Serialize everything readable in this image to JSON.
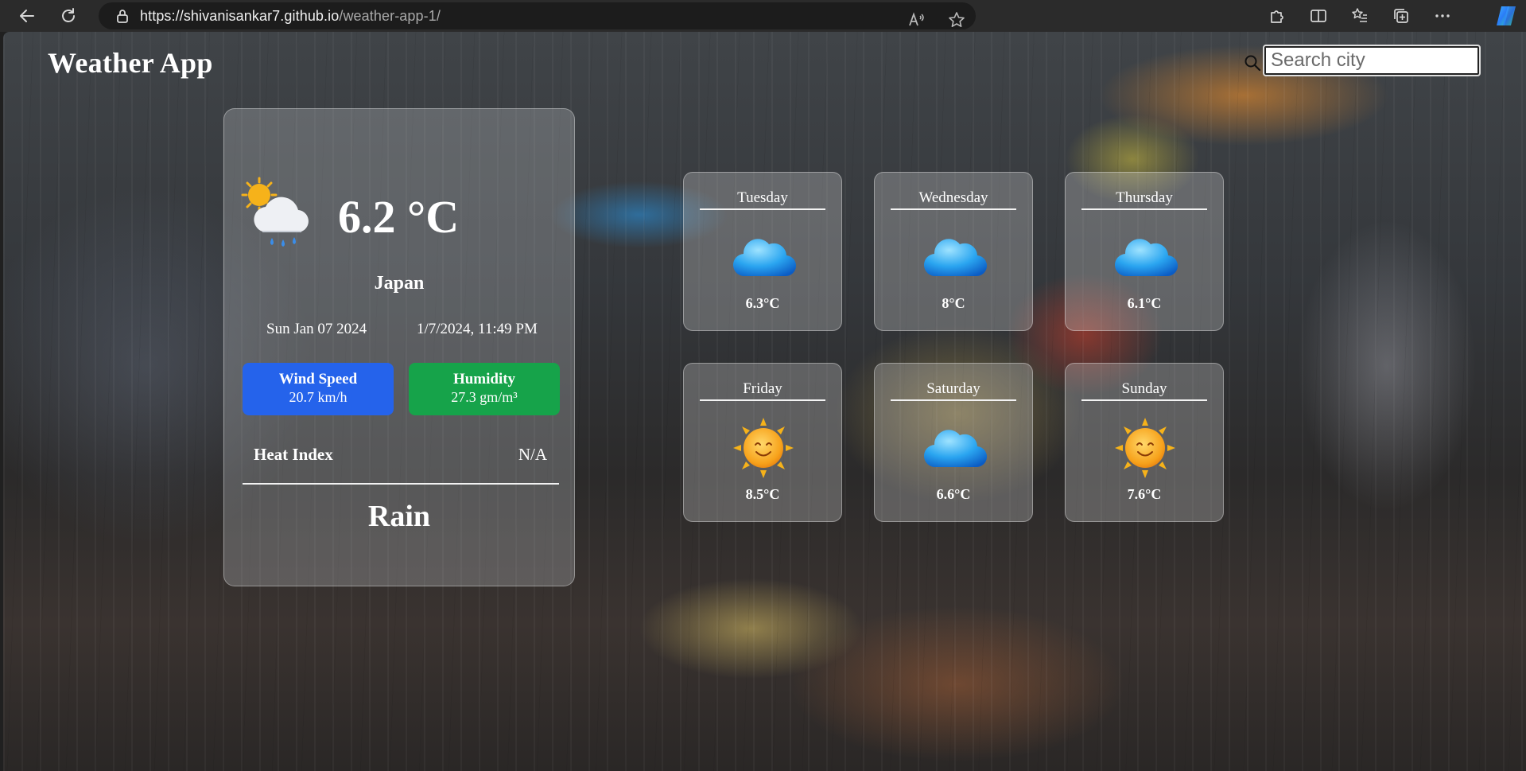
{
  "browser": {
    "url_host": "https://shivanisankar7.github.io",
    "url_path": "/weather-app-1/"
  },
  "app": {
    "title": "Weather App",
    "search_placeholder": "Search city"
  },
  "current": {
    "temperature": "6.2 °C",
    "icon": "sun-cloud-rain-icon",
    "city": "Japan",
    "date": "Sun Jan 07 2024",
    "time": "1/7/2024, 11:49 PM",
    "wind_label": "Wind Speed",
    "wind_value": "20.7 km/h",
    "humidity_label": "Humidity",
    "humidity_value": "27.3 gm/m³",
    "heat_index_label": "Heat Index",
    "heat_index_value": "N/A",
    "condition": "Rain"
  },
  "forecast": [
    {
      "day": "Tuesday",
      "temp": "6.3°C",
      "icon": "cloud-icon"
    },
    {
      "day": "Wednesday",
      "temp": "8°C",
      "icon": "cloud-icon"
    },
    {
      "day": "Thursday",
      "temp": "6.1°C",
      "icon": "cloud-icon"
    },
    {
      "day": "Friday",
      "temp": "8.5°C",
      "icon": "sun-icon"
    },
    {
      "day": "Saturday",
      "temp": "6.6°C",
      "icon": "cloud-icon"
    },
    {
      "day": "Sunday",
      "temp": "7.6°C",
      "icon": "sun-icon"
    }
  ],
  "colors": {
    "wind_badge": "#2563eb",
    "humidity_badge": "#16a34a"
  }
}
